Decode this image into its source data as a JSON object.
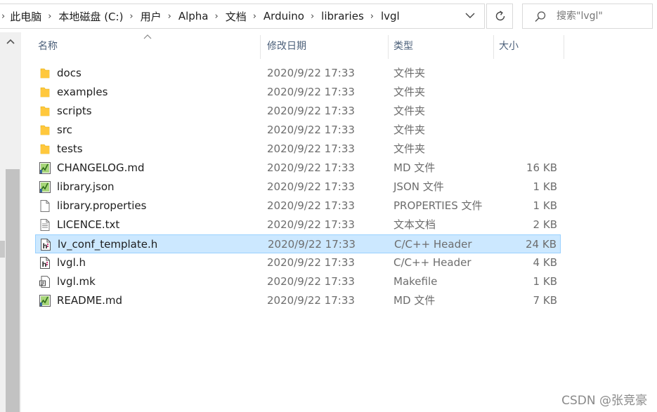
{
  "address_bar": {
    "crumbs": [
      "此电脑",
      "本地磁盘 (C:)",
      "用户",
      "Alpha",
      "文档",
      "Arduino",
      "libraries",
      "lvgl"
    ]
  },
  "search": {
    "placeholder": "搜索\"lvgl\""
  },
  "columns": {
    "name": "名称",
    "date": "修改日期",
    "type": "类型",
    "size": "大小"
  },
  "files": [
    {
      "name": "docs",
      "date": "2020/9/22 17:33",
      "type": "文件夹",
      "size": "",
      "icon": "folder-icon"
    },
    {
      "name": "examples",
      "date": "2020/9/22 17:33",
      "type": "文件夹",
      "size": "",
      "icon": "folder-icon"
    },
    {
      "name": "scripts",
      "date": "2020/9/22 17:33",
      "type": "文件夹",
      "size": "",
      "icon": "folder-icon"
    },
    {
      "name": "src",
      "date": "2020/9/22 17:33",
      "type": "文件夹",
      "size": "",
      "icon": "folder-icon"
    },
    {
      "name": "tests",
      "date": "2020/9/22 17:33",
      "type": "文件夹",
      "size": "",
      "icon": "folder-icon"
    },
    {
      "name": "CHANGELOG.md",
      "date": "2020/9/22 17:33",
      "type": "MD 文件",
      "size": "16 KB",
      "icon": "markdown-file-icon"
    },
    {
      "name": "library.json",
      "date": "2020/9/22 17:33",
      "type": "JSON 文件",
      "size": "1 KB",
      "icon": "json-file-icon"
    },
    {
      "name": "library.properties",
      "date": "2020/9/22 17:33",
      "type": "PROPERTIES 文件",
      "size": "1 KB",
      "icon": "blank-file-icon"
    },
    {
      "name": "LICENCE.txt",
      "date": "2020/9/22 17:33",
      "type": "文本文档",
      "size": "2 KB",
      "icon": "text-file-icon"
    },
    {
      "name": "lv_conf_template.h",
      "date": "2020/9/22 17:33",
      "type": "C/C++ Header",
      "size": "24 KB",
      "icon": "header-file-icon",
      "selected": true
    },
    {
      "name": "lvgl.h",
      "date": "2020/9/22 17:33",
      "type": "C/C++ Header",
      "size": "4 KB",
      "icon": "header-file-icon"
    },
    {
      "name": "lvgl.mk",
      "date": "2020/9/22 17:33",
      "type": "Makefile",
      "size": "1 KB",
      "icon": "makefile-icon"
    },
    {
      "name": "README.md",
      "date": "2020/9/22 17:33",
      "type": "MD 文件",
      "size": "7 KB",
      "icon": "markdown-file-icon"
    }
  ],
  "watermark": "CSDN @张竞豪",
  "colors": {
    "selection_bg": "#cce8ff",
    "selection_border": "#99d1ff",
    "folder": "#ffc83d",
    "header_text": "#4c607a"
  }
}
